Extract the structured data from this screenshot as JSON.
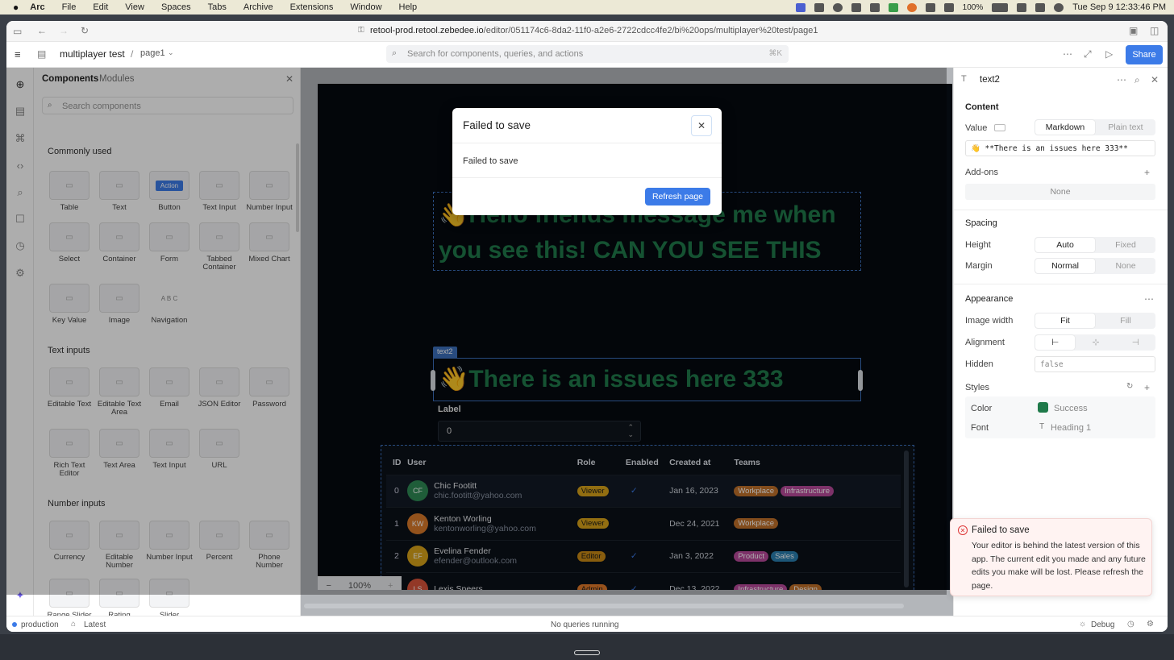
{
  "menubar": {
    "app": "Arc",
    "items": [
      "File",
      "Edit",
      "View",
      "Spaces",
      "Tabs",
      "Archive",
      "Extensions",
      "Window",
      "Help"
    ],
    "battery": "100%",
    "clock": "Tue Sep 9  12:33:46 PM"
  },
  "browser": {
    "url_host": "retool-prod.retool.zebedee.io",
    "url_path": "/editor/051174c6-8da2-11f0-a2e6-2722cdcc4fe2/bi%20ops/multiplayer%20test/page1"
  },
  "header": {
    "app_name": "multiplayer test",
    "separator": "/",
    "page": "page1",
    "search_placeholder": "Search for components, queries, and actions",
    "search_shortcut": "⌘K",
    "share": "Share"
  },
  "panel": {
    "tabs": [
      "Components",
      "Modules"
    ],
    "search_placeholder": "Search components",
    "sections": [
      {
        "title": "Commonly used",
        "items": [
          "Table",
          "Text",
          "Button",
          "Text Input",
          "Number Input",
          "Select",
          "Container",
          "Form",
          "Tabbed Container",
          "Mixed Chart",
          "Key Value",
          "Image",
          "Navigation"
        ]
      },
      {
        "title": "Text inputs",
        "items": [
          "Editable Text",
          "Editable Text Area",
          "Email",
          "JSON Editor",
          "Password",
          "Rich Text Editor",
          "Text Area",
          "Text Input",
          "URL"
        ]
      },
      {
        "title": "Number inputs",
        "items": [
          "Currency",
          "Editable Number",
          "Number Input",
          "Percent",
          "Phone Number",
          "Range Slider",
          "Rating",
          "Slider"
        ]
      }
    ],
    "button_tile_text": "Action",
    "nav_tile_text": "A B C"
  },
  "canvas": {
    "text1": "Hello friends message me when you see this! CAN YOU SEE THIS",
    "text2_tag": "text2",
    "text2": "There is an issues here 333",
    "wave_emoji": "👋",
    "number_label": "Label",
    "number_value": "0",
    "zoom": "100%",
    "table": {
      "headers": [
        "ID",
        "User",
        "Role",
        "Enabled",
        "Created at",
        "Teams"
      ],
      "rows": [
        {
          "id": "0",
          "initials": "CF",
          "name": "Chic Footitt",
          "email": "chic.footitt@yahoo.com",
          "role": "Viewer",
          "enabled": true,
          "created": "Jan 16, 2023",
          "teams": [
            "Workplace",
            "Infrastructure"
          ]
        },
        {
          "id": "1",
          "initials": "KW",
          "name": "Kenton Worling",
          "email": "kentonworling@yahoo.com",
          "role": "Viewer",
          "enabled": false,
          "created": "Dec 24, 2021",
          "teams": [
            "Workplace"
          ]
        },
        {
          "id": "2",
          "initials": "EF",
          "name": "Evelina Fender",
          "email": "efender@outlook.com",
          "role": "Editor",
          "enabled": true,
          "created": "Jan 3, 2022",
          "teams": [
            "Product",
            "Sales"
          ]
        },
        {
          "id": "3",
          "initials": "LS",
          "name": "Lexis Speers",
          "email": "",
          "role": "Admin",
          "enabled": true,
          "created": "Dec 13, 2022",
          "teams": [
            "Infrastructure",
            "Design"
          ]
        }
      ]
    }
  },
  "inspector": {
    "component": "text2",
    "content": "Content",
    "value_label": "Value",
    "value_modes": [
      "Markdown",
      "Plain text"
    ],
    "value_text": "👋 **There is an issues here 333**",
    "addons": "Add-ons",
    "addons_none": "None",
    "spacing": "Spacing",
    "height_label": "Height",
    "height_modes": [
      "Auto",
      "Fixed"
    ],
    "margin_label": "Margin",
    "margin_modes": [
      "Normal",
      "None"
    ],
    "appearance": "Appearance",
    "image_width_label": "Image width",
    "image_width_modes": [
      "Fit",
      "Fill"
    ],
    "alignment_label": "Alignment",
    "hidden_label": "Hidden",
    "hidden_value": "false",
    "styles": "Styles",
    "color_label": "Color",
    "color_value": "Success",
    "font_label": "Font",
    "font_value": "Heading 1"
  },
  "modal": {
    "title": "Failed to save",
    "body": "Failed to save",
    "button": "Refresh page"
  },
  "toast": {
    "title": "Failed to save",
    "body": "Your editor is behind the latest version of this app. The current edit you made and any future edits you make will be lost. Please refresh the page."
  },
  "status": {
    "env": "production",
    "version": "Latest",
    "queries": "No queries running",
    "debug": "Debug"
  },
  "colors": {
    "accent": "#3c7be8",
    "success_text": "#1f7a4a",
    "viewer": "#d8a31a",
    "editor": "#c98a16",
    "admin": "#e07a2a",
    "workplace": "#c0712a",
    "infrastructure": "#b84a9b",
    "product": "#b84a9b",
    "sales": "#2a7fb0",
    "design": "#c0712a"
  }
}
